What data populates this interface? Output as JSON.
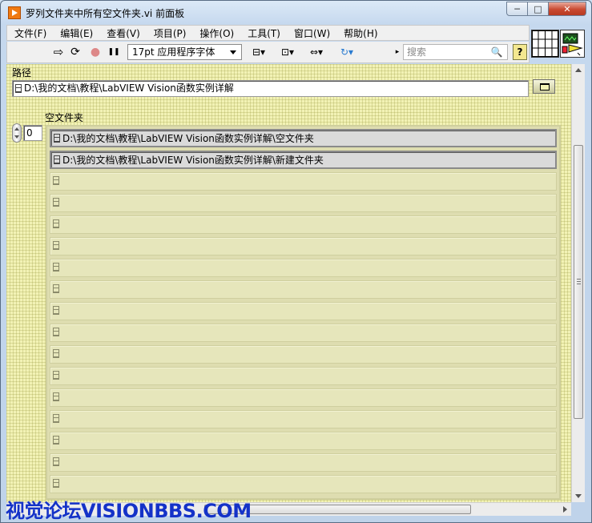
{
  "window": {
    "title": "罗列文件夹中所有空文件夹.vi 前面板",
    "controls": {
      "minimize": "─",
      "maximize": "□",
      "close": "✕"
    }
  },
  "menu": {
    "items": [
      {
        "label": "文件(F)"
      },
      {
        "label": "编辑(E)"
      },
      {
        "label": "查看(V)"
      },
      {
        "label": "项目(P)"
      },
      {
        "label": "操作(O)"
      },
      {
        "label": "工具(T)"
      },
      {
        "label": "窗口(W)"
      },
      {
        "label": "帮助(H)"
      }
    ]
  },
  "toolbar": {
    "run_icon": "⇨",
    "run_continuous_icon": "⟳",
    "abort_icon": "●",
    "pause_icon": "❚❚",
    "font_value": "17pt 应用程序字体",
    "align_icon": "⊟▾",
    "distribute_icon": "⊡▾",
    "resize_icon": "⇔▾",
    "reorder_icon": "↻▾",
    "search_arrow": "▸",
    "search_placeholder": "搜索",
    "search_icon": "🔍",
    "help_label": "?"
  },
  "panel": {
    "path_label": "路径",
    "path_value": "D:\\我的文档\\教程\\LabVIEW Vision函数实例详解",
    "array_label": "空文件夹",
    "index_value": "0",
    "array_items": [
      "D:\\我的文档\\教程\\LabVIEW Vision函数实例详解\\空文件夹",
      "D:\\我的文档\\教程\\LabVIEW Vision函数实例详解\\新建文件夹"
    ],
    "empty_rows": 15
  },
  "watermark": "视觉论坛VISIONBBS.COM",
  "colors": {
    "panel_bg": "#f2f2b5",
    "watermark": "#1432c8",
    "close_button": "#c94a31"
  }
}
